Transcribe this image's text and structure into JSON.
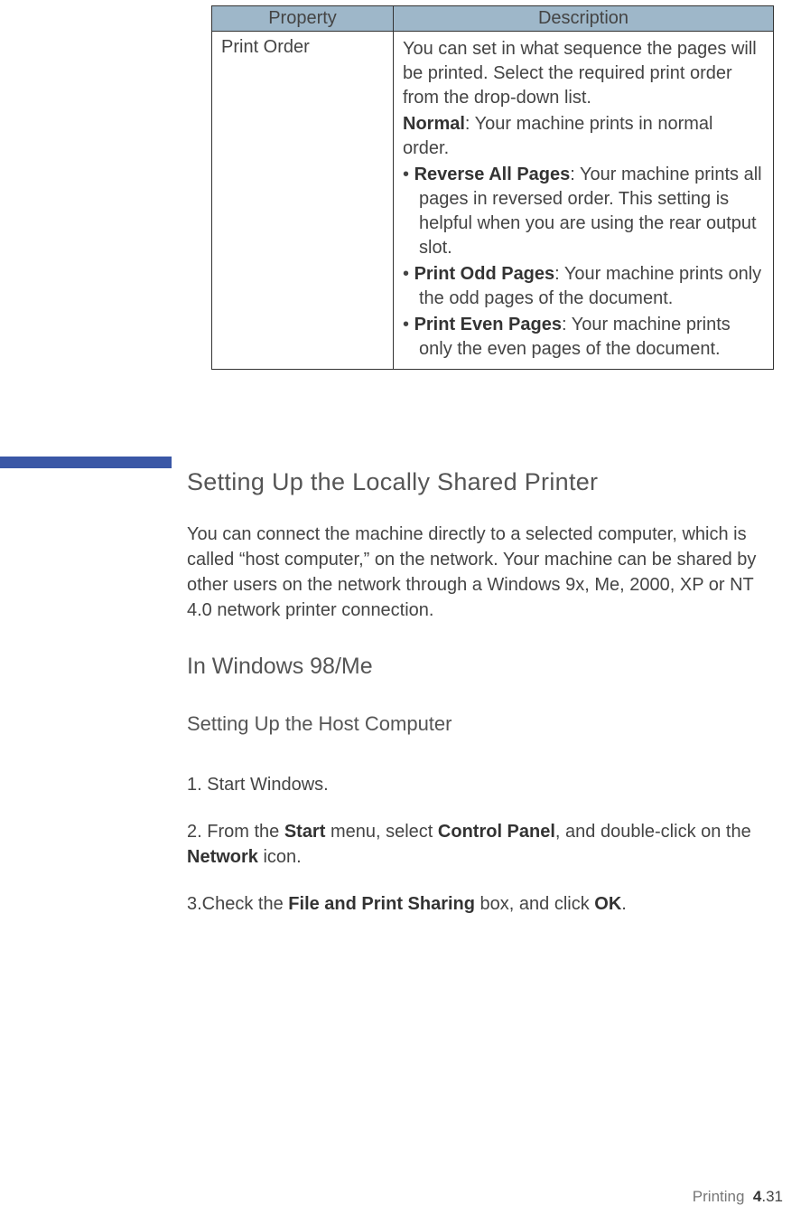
{
  "table": {
    "headers": {
      "property": "Property",
      "description": "Description"
    },
    "row": {
      "property": "Print Order",
      "intro": "You can set in what sequence the pages will be printed. Select the required print order from the drop-down list.",
      "normal_label": "Normal",
      "normal_text": ": Your machine prints in normal order.",
      "b1_label": "Reverse All Pages",
      "b1_text": ": Your machine prints all pages in reversed order. This setting is helpful when you are using the rear output slot.",
      "b2_label": "Print Odd Pages",
      "b2_text": ": Your machine prints only the odd pages of the document.",
      "b3_label": "Print Even Pages",
      "b3_text": ": Your machine prints only the even pages of the document."
    }
  },
  "section_heading": "Setting Up the Locally Shared Printer",
  "section_body": "You can connect the machine directly to a selected computer, which is called “host computer,” on the network. Your machine can be shared by other users on the network through a Windows 9x, Me, 2000, XP or NT 4.0 network printer connection.",
  "subhead1": "In Windows 98/Me",
  "subhead2": "Setting Up the Host Computer",
  "steps": {
    "s1": "1. Start Windows.",
    "s2a": "2. From the ",
    "s2b_bold": "Start",
    "s2c": " menu, select ",
    "s2d_bold": "Control Panel",
    "s2e": ", and double-click on the ",
    "s2f_bold": "Network",
    "s2g": " icon.",
    "s3a": "3.Check the ",
    "s3b_bold": "File and Print Sharing",
    "s3c": " box, and click ",
    "s3d_bold": "OK",
    "s3e": "."
  },
  "footer": {
    "section": "Printing",
    "chapter": "4",
    "page": ".31"
  }
}
